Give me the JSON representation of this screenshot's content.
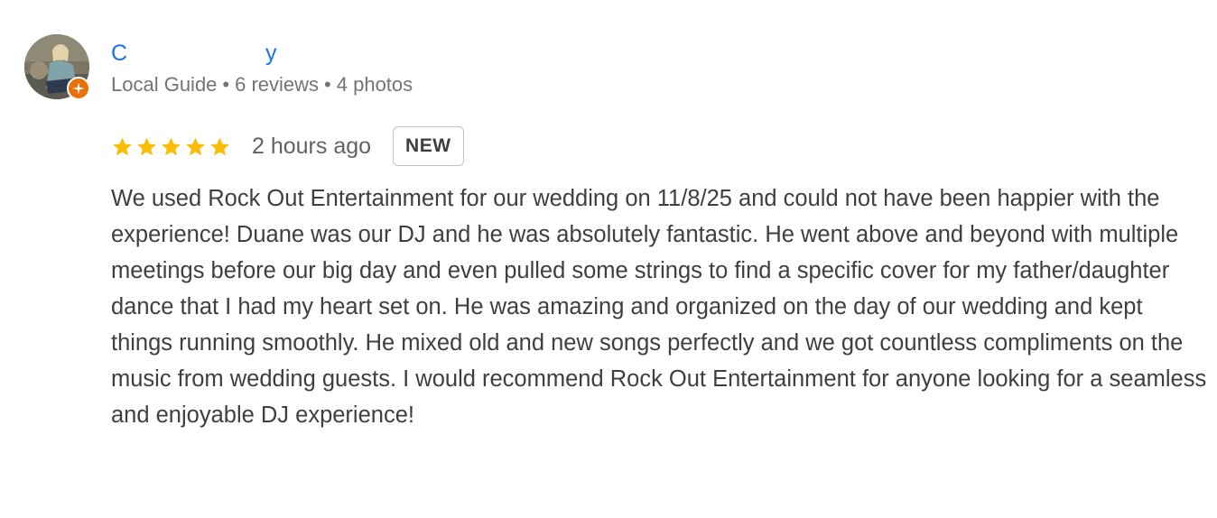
{
  "reviewer": {
    "name_visible_start": "C",
    "name_visible_end": "y",
    "local_guide": "Local Guide",
    "reviews": "6 reviews",
    "photos": "4 photos",
    "separator": "•"
  },
  "review": {
    "rating": 5,
    "max_rating": 5,
    "time": "2 hours ago",
    "badge": "NEW",
    "text": "We used Rock Out Entertainment for our wedding on 11/8/25 and could not have been happier with the experience! Duane was our DJ and he was absolutely fantastic. He went above and beyond with multiple meetings before our big day and even pulled some strings to find a specific cover for my father/daughter dance that I had my heart set on. He was amazing and organized on the day of our wedding and kept things running smoothly. He mixed old and new songs perfectly and we got countless compliments on the music from wedding guests. I would recommend Rock Out Entertainment for anyone looking for a seamless and enjoyable DJ experience!"
  },
  "colors": {
    "name": "#1a73e8",
    "star": "#fbbc04",
    "guide_badge": "#e8710a",
    "meta": "#70757a"
  },
  "icons": {
    "avatar": "profile-photo",
    "badge": "local-guide-star-icon",
    "star": "star-icon"
  }
}
